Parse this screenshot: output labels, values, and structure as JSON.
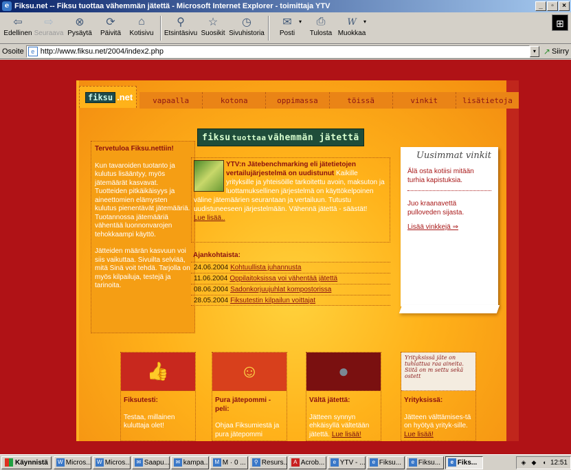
{
  "window": {
    "title": "Fiksu.net -- Fiksu tuottaa vähemmän jätettä - Microsoft Internet Explorer - toimittaja YTV",
    "controls": [
      "_",
      "▫",
      "×"
    ]
  },
  "toolbar": {
    "buttons": [
      {
        "label": "Edellinen",
        "icon": "back-arrow-icon",
        "glyph": "⇦",
        "enabled": true
      },
      {
        "label": "Seuraava",
        "icon": "forward-arrow-icon",
        "glyph": "⇨",
        "enabled": false
      },
      {
        "label": "Pysäytä",
        "icon": "stop-icon",
        "glyph": "⊗",
        "enabled": true
      },
      {
        "label": "Päivitä",
        "icon": "refresh-icon",
        "glyph": "⟳",
        "enabled": true
      },
      {
        "label": "Kotisivu",
        "icon": "home-icon",
        "glyph": "⌂",
        "enabled": true
      },
      {
        "label": "Etsintäsivu",
        "icon": "search-icon",
        "glyph": "⚲",
        "enabled": true
      },
      {
        "label": "Suosikit",
        "icon": "favorites-icon",
        "glyph": "☆",
        "enabled": true
      },
      {
        "label": "Sivuhistoria",
        "icon": "history-icon",
        "glyph": "◷",
        "enabled": true
      },
      {
        "label": "Posti",
        "icon": "mail-icon",
        "glyph": "✉",
        "enabled": true
      },
      {
        "label": "Tulosta",
        "icon": "print-icon",
        "glyph": "⎙",
        "enabled": true
      },
      {
        "label": "Muokkaa",
        "icon": "edit-icon",
        "glyph": "W",
        "enabled": true
      }
    ]
  },
  "address": {
    "label": "Osoite",
    "url": "http://www.fiksu.net/2004/index2.php",
    "go_label": "Siirry"
  },
  "site": {
    "logo_box": "fiksu",
    "logo_suffix": ".net",
    "nav": [
      "vapaalla",
      "kotona",
      "oppimassa",
      "töissä",
      "vinkit",
      "lisätietoja"
    ],
    "headline_1": "fiksu",
    "headline_2": "tuottaa",
    "headline_3": "vähemmän jätettä",
    "welcome": {
      "title": "Tervetuloa Fiksu.nettiin!",
      "p1": "Kun tavaroiden tuotanto ja kulutus lisääntyy, myös jätemäärät kasvavat. Tuotteiden pitkäikäisyys ja aineettomien elämysten kulutus pienentävät jätemääriä. Tuotannossa jätemääriä vähentää luonnonvarojen tehokkaampi käyttö.",
      "p2": "Jätteiden määrän kasvuun voi siis vaikuttaa. Sivuilta selviää, mitä Sinä voit tehdä. Tarjolla on myös kilpailuja, testejä ja tarinoita."
    },
    "feature": {
      "title": "YTV:n Jätebenchmarking eli jätetietojen vertailujärjestelmä on uudistunut",
      "body": "Kaikille yrityksille ja yhteisöille tarkoitettu avoin, maksuton ja luottamuksellinen järjestelmä on käyttökelpoinen väline jätemäärien seurantaan ja vertailuun. Tutustu uudistuneeseen järjestelmään. Vähennä jätettä - säästät!",
      "link": "Lue lisää.."
    },
    "news": {
      "title": "Ajankohtaista:",
      "items": [
        {
          "date": "24.06.2004",
          "text": "Kohtuullista juhannusta"
        },
        {
          "date": "11.06.2004",
          "text": "Oppilaitoksissa voi vähentää jätettä"
        },
        {
          "date": "08.06.2004",
          "text": "Sadonkorjuujuhlat kompostorissa"
        },
        {
          "date": "28.05.2004",
          "text": "Fiksutestin kilpailun voittajat"
        }
      ]
    },
    "tips": {
      "title": "Uusimmat vinkit",
      "tip1": "Älä osta kotiisi mitään turhia kapistuksia.",
      "tip2": "Juo kraanavettä pulloveden sijasta.",
      "more": "Lisää vinkkejä ⇒"
    },
    "cards": [
      {
        "title": "Fiksutesti:",
        "body": "Testaa, millainen kuluttaja olet!",
        "link": "",
        "icon": "thumbs-up-icon",
        "glyph": "👍",
        "bg": "#c8281e"
      },
      {
        "title": "Pura jätepommi -peli:",
        "body": "Ohjaa Fiksumiestä ja pura jätepommi",
        "link": "",
        "icon": "superhero-icon",
        "glyph": "☺",
        "bg": "#d8401c"
      },
      {
        "title": "Vältä jätettä:",
        "body": "Jätteen synnyn ehkäisyllä vältetään jätettä.",
        "link": "Lue lisää!",
        "icon": "globe-bomb-icon",
        "glyph": "●",
        "bg": "#7a1010"
      },
      {
        "title": "Yrityksissä:",
        "body": "Jätteen välttämises-tä on hyötyä yrityk-sille.",
        "link": "Lue lisää!",
        "icon": "handwriting-note-icon",
        "glyph": "✎",
        "bg": "#f4ece0"
      }
    ],
    "card_image_texts": {
      "yrityksissa": "Yrityksissä jäte on tuhlattua raa aineita. Siitä on m settu sekä ostett"
    }
  },
  "taskbar": {
    "start": "Käynnistä",
    "tasks": [
      "Micros...",
      "Micros...",
      "Saapu...",
      "kampa...",
      "M · 0 ...",
      "Resurs...",
      "Acrob...",
      "YTV - ...",
      "Fiksu...",
      "Fiksu...",
      "Fiks..."
    ],
    "active_index": 10,
    "clock": "12:51"
  }
}
